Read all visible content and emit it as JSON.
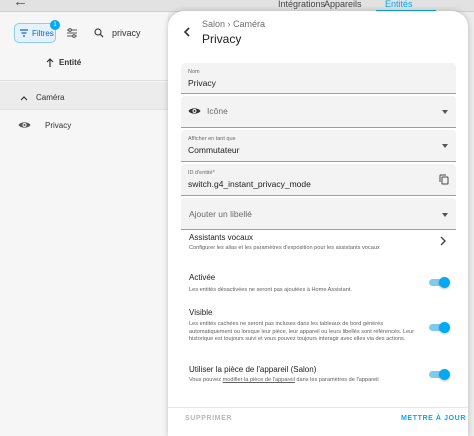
{
  "background": {
    "tabs": [
      {
        "label": "Intégrations"
      },
      {
        "label": "Appareils"
      },
      {
        "label": "Entités"
      }
    ],
    "filters_label": "Filtres",
    "filters_count": "1",
    "search_value": "privacy",
    "column_entity": "Entité",
    "group_label": "Caméra",
    "row_label": "Privacy"
  },
  "dialog": {
    "breadcrumb": "Salon › Caméra",
    "title": "Privacy",
    "name_field": {
      "label": "Nom",
      "value": "Privacy"
    },
    "icon_field": {
      "placeholder": "Icône",
      "icon": "eye-icon"
    },
    "show_as_field": {
      "label": "Afficher en tant que",
      "value": "Commutateur"
    },
    "entity_id_field": {
      "label": "ID d'entité*",
      "value": "switch.g4_instant_privacy_mode"
    },
    "label_field": {
      "placeholder": "Ajouter un libellé"
    },
    "voice": {
      "title": "Assistants vocaux",
      "desc": "Configurer les alias et les paramètres d'exposition pour les assistants vocaux"
    },
    "enabled": {
      "title": "Activée",
      "desc": "Les entités désactivées ne seront pas ajoutées à Home Assistant.",
      "on": true
    },
    "visible": {
      "title": "Visible",
      "desc": "Les entités cachées ne seront pas incluses dans les tableaux de bord générés automatiquement ou lorsque leur pièce, leur appareil ou leurs libellés sont référencés. Leur historique est toujours suivi et vous pouvez toujours interagir avec elles via des actions.",
      "on": true
    },
    "area": {
      "title": "Utiliser la pièce de l'appareil (Salon)",
      "desc_before": "Vous pouvez ",
      "desc_link": "modifier la pièce de l'appareil",
      "desc_after": " dans les paramètres de l'appareil",
      "on": true
    },
    "delete_label": "SUPPRIMER",
    "update_label": "METTRE À JOUR"
  },
  "colors": {
    "accent": "#03a9f4",
    "toggle_track": "#7fcaf1"
  }
}
